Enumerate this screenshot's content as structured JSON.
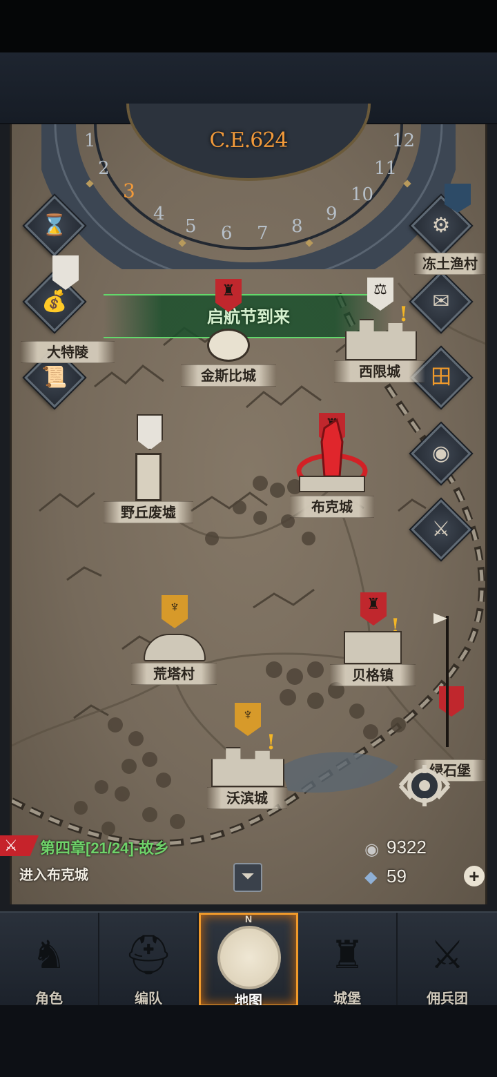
{
  "calendar": {
    "year": "C.E.624",
    "months": [
      "1",
      "2",
      "3",
      "4",
      "5",
      "6",
      "7",
      "8",
      "9",
      "10",
      "11",
      "12"
    ],
    "current_month": "3"
  },
  "event": {
    "text": "启航节到来"
  },
  "locations": [
    {
      "id": "dateling",
      "name": "大特陵"
    },
    {
      "id": "jinsibi",
      "name": "金斯比城"
    },
    {
      "id": "xixian",
      "name": "西限城"
    },
    {
      "id": "dongtu",
      "name": "冻土渔村"
    },
    {
      "id": "yeqiu",
      "name": "野丘废墟"
    },
    {
      "id": "buke",
      "name": "布克城"
    },
    {
      "id": "huangta",
      "name": "荒塔村"
    },
    {
      "id": "beige",
      "name": "贝格镇"
    },
    {
      "id": "wobin",
      "name": "沃滨城"
    },
    {
      "id": "lvshi",
      "name": "绿石堡"
    }
  ],
  "quest": {
    "chapter": "第四章[21/24]-故乡",
    "objective": "进入布克城"
  },
  "resources": {
    "silver": "9322",
    "crystal": "59"
  },
  "nav": [
    {
      "label": "角色"
    },
    {
      "label": "编队"
    },
    {
      "label": "地图"
    },
    {
      "label": "城堡"
    },
    {
      "label": "佣兵团"
    }
  ],
  "colors": {
    "accent": "#f09a2b",
    "quest_green": "#6fd36a",
    "event_green": "#63d86b",
    "map_parchment": "#766a5b",
    "banner_red": "#c0272d",
    "banner_gold": "#d79a2a"
  },
  "icons": {
    "left_rail": [
      "hourglass-icon",
      "loot-bag-icon",
      "scroll-icon"
    ],
    "right_rail": [
      "gear-icon",
      "mail-icon",
      "calendar-grid-icon",
      "coin-icon",
      "helmet-sword-icon"
    ]
  }
}
